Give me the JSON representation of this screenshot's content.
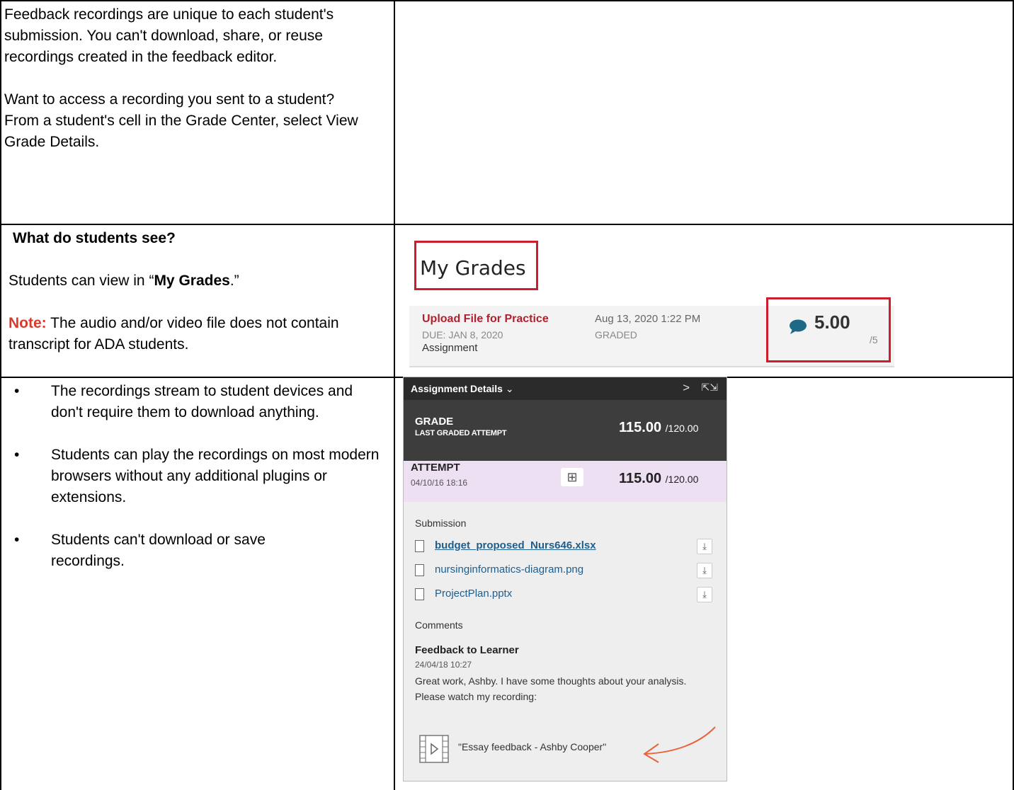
{
  "row1": {
    "para1": "Feedback recordings are unique to each student's submission. You can't download, share, or reuse recordings created in the feedback editor.",
    "para2": "Want to access a recording you sent to a student? From a student's cell in the Grade Center, select View Grade Details."
  },
  "row2": {
    "heading": "What do students see?",
    "view_prefix": "Students can view in “",
    "view_bold": "My Grades",
    "view_suffix": ".”",
    "note_label": "Note:",
    "note_text": " The audio and/or video file does not contain transcript for ADA students."
  },
  "row3": {
    "bullets": [
      "The recordings stream to student devices and don't require them to download anything.",
      "Students can play the recordings on most modern browsers without any additional plugins or extensions.",
      "Students can't download or save recordings."
    ]
  },
  "my_grades": {
    "title": "My Grades",
    "item_title": "Upload File for Practice",
    "due": "DUE: JAN 8, 2020",
    "type": "Assignment",
    "date": "Aug 13, 2020 1:22 PM",
    "status": "GRADED",
    "score": "5.00",
    "out_of": "/5",
    "colors": {
      "highlight_box": "#cc1f2e",
      "item_title": "#b21f2d",
      "comment_icon": "#1d6a86"
    }
  },
  "panel": {
    "header_title": "Assignment Details",
    "header_icons": [
      "chevron-down-icon",
      "chevron-right-icon",
      "expand-icon"
    ],
    "grade_label": "GRADE",
    "grade_sub": "LAST GRADED ATTEMPT",
    "grade_score": "115.00",
    "grade_out": "/120.00",
    "attempt_label": "ATTEMPT",
    "attempt_date": "04/10/16 18:16",
    "attempt_score": "115.00",
    "attempt_out": "/120.00",
    "submission_label": "Submission",
    "files": [
      {
        "name": "budget_proposed_Nurs646.xlsx"
      },
      {
        "name": "nursinginformatics-diagram.png"
      },
      {
        "name": "ProjectPlan.pptx"
      }
    ],
    "comments_label": "Comments",
    "feedback_title": "Feedback to Learner",
    "feedback_date": "24/04/18 10:27",
    "feedback_message": "Great work, Ashby. I have some thoughts about your analysis. Please watch my recording:",
    "recording_name": "\"Essay feedback - Ashby Cooper\"",
    "colors": {
      "header_bg": "#2b2b2b",
      "grade_bg": "#3d3d3d",
      "attempt_bg": "#ece0f2",
      "link": "#1f5e8c",
      "arrow": "#e8643a"
    }
  }
}
